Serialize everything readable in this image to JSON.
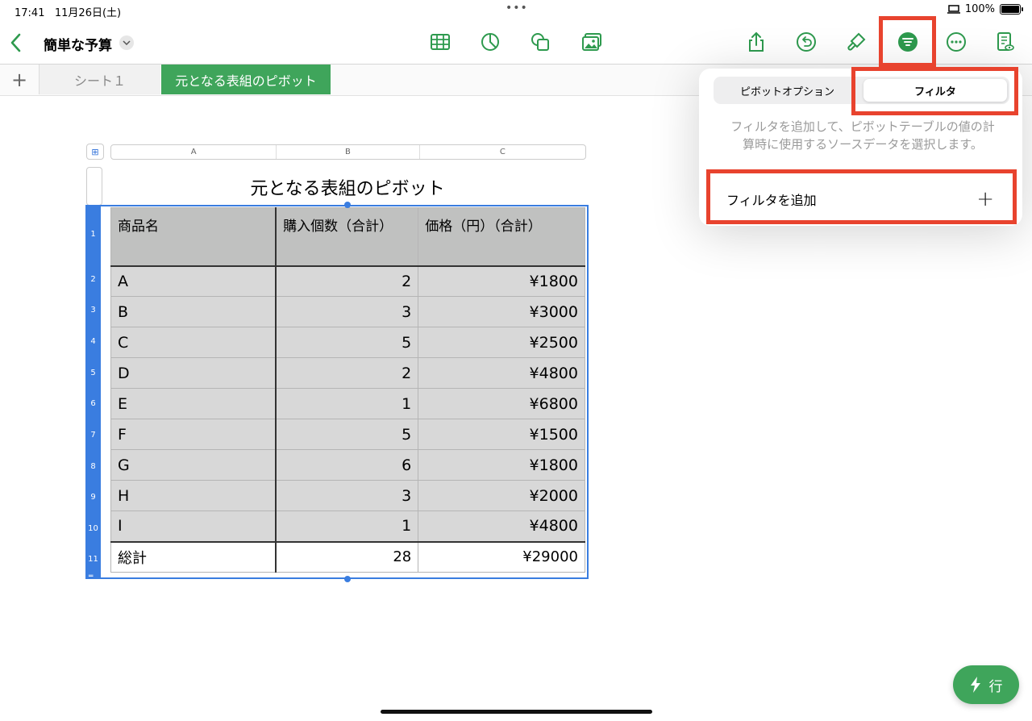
{
  "status": {
    "time": "17:41",
    "date": "11月26日(土)",
    "battery": "100%"
  },
  "toolbar": {
    "doc_title": "簡単な予算",
    "icons": [
      "back-chevron-icon",
      "table-icon",
      "chart-icon",
      "shapes-icon",
      "media-icon",
      "share-icon",
      "undo-icon",
      "format-brush-icon",
      "organize-filter-icon",
      "more-icon",
      "doc-options-icon"
    ]
  },
  "tabs": {
    "add": "+",
    "sheet1": "シート１",
    "active": "元となる表組のピボット"
  },
  "columns": [
    "A",
    "B",
    "C"
  ],
  "table": {
    "title": "元となる表組のピボット",
    "headers": [
      "商品名",
      "購入個数（合計）",
      "価格（円）（合計）"
    ],
    "rows": [
      {
        "num": "2",
        "name": "A",
        "qty": "2",
        "price": "¥1800"
      },
      {
        "num": "3",
        "name": "B",
        "qty": "3",
        "price": "¥3000"
      },
      {
        "num": "4",
        "name": "C",
        "qty": "5",
        "price": "¥2500"
      },
      {
        "num": "5",
        "name": "D",
        "qty": "2",
        "price": "¥4800"
      },
      {
        "num": "6",
        "name": "E",
        "qty": "1",
        "price": "¥6800"
      },
      {
        "num": "7",
        "name": "F",
        "qty": "5",
        "price": "¥1500"
      },
      {
        "num": "8",
        "name": "G",
        "qty": "6",
        "price": "¥1800"
      },
      {
        "num": "9",
        "name": "H",
        "qty": "3",
        "price": "¥2000"
      },
      {
        "num": "10",
        "name": "I",
        "qty": "1",
        "price": "¥4800"
      }
    ],
    "total": {
      "num": "11",
      "name": "総計",
      "qty": "28",
      "price": "¥29000"
    },
    "header_num": "1"
  },
  "popover": {
    "tab_left": "ピボットオプション",
    "tab_right": "フィルタ",
    "description": "フィルタを追加して、ピボットテーブルの値の計算時に使用するソースデータを選択します。",
    "add_filter": "フィルタを追加",
    "plus": "+"
  },
  "fab": {
    "label": "行"
  },
  "colors": {
    "accent": "#3fa55b",
    "selection": "#3a7de0",
    "highlight": "#e8432e"
  }
}
